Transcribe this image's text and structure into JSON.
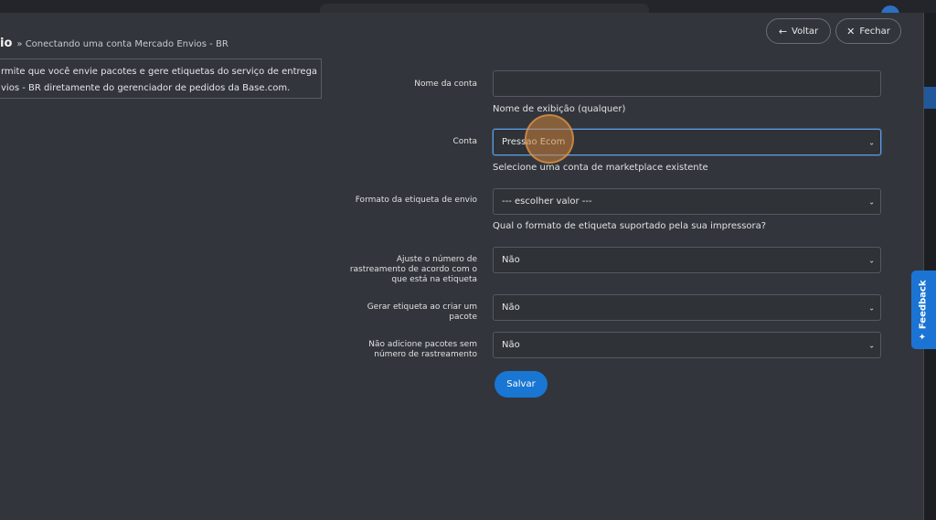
{
  "breadcrumb": {
    "title": "io",
    "subtitle": "» Conectando uma conta Mercado Envios - BR"
  },
  "header_buttons": {
    "back": {
      "icon": "arrow-left-icon",
      "label": "Voltar"
    },
    "close": {
      "icon": "close-icon",
      "label": "Fechar"
    }
  },
  "description": {
    "line1": "rmite que você envie pacotes e gere etiquetas do serviço de entrega",
    "line2": "vios - BR diretamente do gerenciador de pedidos da Base.com."
  },
  "form": {
    "account_name": {
      "label": "Nome da conta",
      "value": "",
      "hint": "Nome de exibição (qualquer)"
    },
    "account": {
      "label": "Conta",
      "value": "Pressao Ecom",
      "hint": "Selecione uma conta de marketplace existente"
    },
    "label_format": {
      "label": "Formato da etiqueta de envio",
      "value": "--- escolher valor ---",
      "hint": "Qual o formato de etiqueta suportado pela sua impressora?"
    },
    "adjust_tracking": {
      "label_lines": [
        "Ajuste o número de",
        "rastreamento de acordo com o",
        "que está na etiqueta"
      ],
      "value": "Não"
    },
    "generate_label": {
      "label_lines": [
        "Gerar etiqueta ao criar um",
        "pacote"
      ],
      "value": "Não"
    },
    "no_packages": {
      "label_lines": [
        "Não adicione pacotes sem",
        "número de rastreamento"
      ],
      "value": "Não"
    },
    "save_label": "Salvar"
  },
  "feedback": {
    "icon": "sparkle-icon",
    "label": "Feedback"
  },
  "colors": {
    "accent": "#1976d2",
    "focus_border": "#5c9ce6",
    "modal_bg": "#32353b",
    "cursor_highlight": "#cc843c"
  }
}
